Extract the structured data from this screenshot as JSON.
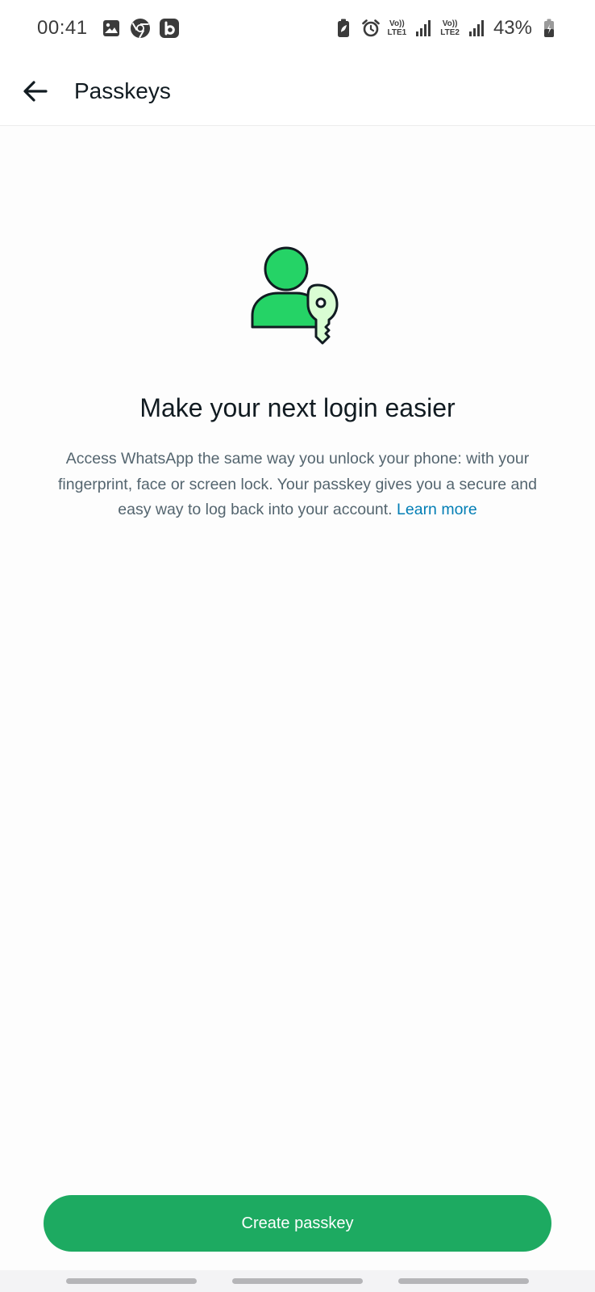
{
  "status_bar": {
    "time": "00:41",
    "left_icons": [
      "gallery-icon",
      "chrome-icon",
      "b-app-icon"
    ],
    "right_icons": [
      "battery-saver-icon",
      "alarm-icon"
    ],
    "sim1_volte": "Vo))",
    "sim1_label": "LTE1",
    "sim2_volte": "Vo))",
    "sim2_label": "LTE2",
    "battery": "43%"
  },
  "app_bar": {
    "title": "Passkeys",
    "back_icon": "arrow-left-icon"
  },
  "main": {
    "illustration_icon": "user-key-icon",
    "headline": "Make your next login easier",
    "description": "Access WhatsApp the same way you unlock your phone: with your fingerprint, face or screen lock. Your passkey gives you a secure and easy way to log back into your account. ",
    "learn_more": "Learn more"
  },
  "footer": {
    "cta_label": "Create passkey"
  },
  "colors": {
    "accent": "#1daa61",
    "link": "#027eb5",
    "illustration_green": "#25d366",
    "key_fill": "#d9fdd3"
  }
}
